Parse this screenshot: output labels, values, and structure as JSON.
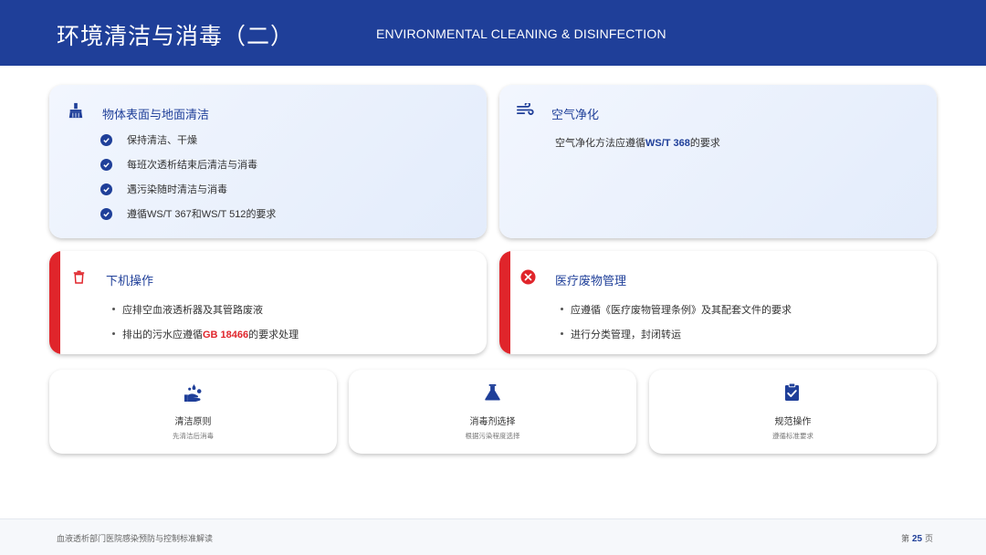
{
  "header": {
    "title": "环境清洁与消毒（二）",
    "subtitle": "ENVIRONMENTAL CLEANING & DISINFECTION"
  },
  "cards": {
    "surface": {
      "icon": "broom-icon",
      "title": "物体表面与地面清洁",
      "items": [
        "保持清洁、干燥",
        "每班次透析结束后清洁与消毒",
        "遇污染随时清洁与消毒"
      ],
      "last_prefix": "遵循",
      "last_code1": "WS/T 367",
      "last_mid": "和",
      "last_code2": "WS/T 512",
      "last_suffix": "的要求"
    },
    "air": {
      "icon": "wind-icon",
      "title": "空气净化",
      "text_prefix": "空气净化方法应遵循",
      "text_code": "WS/T 368",
      "text_suffix": "的要求"
    },
    "shutdown": {
      "icon": "trash-icon",
      "title": "下机操作",
      "item1": "应排空血液透析器及其管路废液",
      "item2_prefix": "排出的污水应遵循",
      "item2_code": "GB 18466",
      "item2_suffix": "的要求处理"
    },
    "waste": {
      "icon": "close-circle-icon",
      "title": "医疗废物管理",
      "item1": "应遵循《医疗废物管理条例》及其配套文件的要求",
      "item2": "进行分类管理，封闭转运"
    }
  },
  "mini_cards": [
    {
      "icon": "hand-wash-icon",
      "title": "清洁原则",
      "sub": "先清洁后消毒"
    },
    {
      "icon": "flask-icon",
      "title": "消毒剂选择",
      "sub": "根据污染程度选择"
    },
    {
      "icon": "clipboard-check-icon",
      "title": "规范操作",
      "sub": "遵循标准要求"
    }
  ],
  "footer": {
    "left": "血液透析部门医院感染预防与控制标准解读",
    "page_prefix": "第",
    "page_number": "25",
    "page_suffix": "页"
  },
  "colors": {
    "primary": "#1f3f99",
    "accent_red": "#e0252b"
  }
}
